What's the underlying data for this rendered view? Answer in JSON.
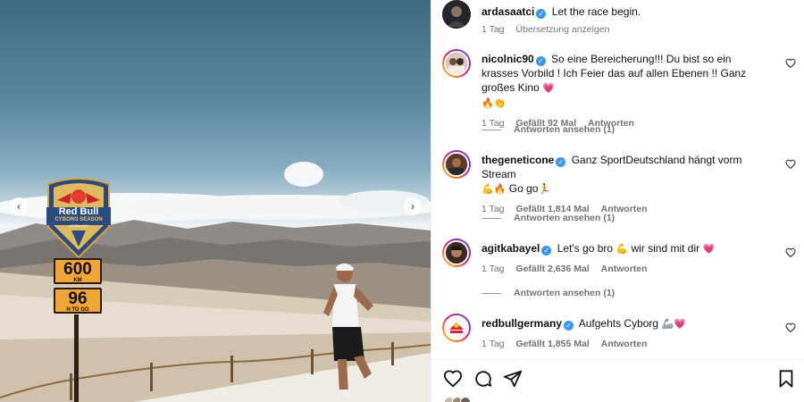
{
  "photo": {
    "sign": {
      "brand": "Red Bull",
      "event": "CYBORG SEASON",
      "sub": "ULTRA 600",
      "distance_value": "600",
      "distance_unit": "KM",
      "hours_value": "96",
      "hours_unit": "H TO GO"
    },
    "prev_icon": "chevron-left-icon",
    "next_icon": "chevron-right-icon"
  },
  "caption": {
    "username": "ardasaatci",
    "text": "Let the race begin.",
    "age": "1 Tag",
    "translate_label": "Übersetzung anzeigen"
  },
  "comments": [
    {
      "username": "nicolnic90",
      "text": "So eine Bereicherung!!! Du bist so ein krasses Vorbild ! Ich Feier das auf allen Ebenen !! Ganz großes Kino",
      "emoji_inline": "💗",
      "emoji_line2": "🔥👏",
      "age": "1 Tag",
      "likes": "Gefällt 92 Mal",
      "reply_label": "Antworten",
      "view_replies": "Antworten ansehen (1)"
    },
    {
      "username": "thegeneticone",
      "text": "Ganz SportDeutschland hängt vorm Stream",
      "emoji_line2": "💪🔥",
      "text2": "Go go",
      "emoji_end": "🏃",
      "age": "1 Tag",
      "likes": "Gefällt 1,814 Mal",
      "reply_label": "Antworten",
      "view_replies": "Antworten ansehen (1)"
    },
    {
      "username": "agitkabayel",
      "text": "Let's go bro",
      "emoji_mid": "💪",
      "text2": "wir sind mit dir",
      "emoji_end": "💗",
      "age": "1 Tag",
      "likes": "Gefällt 2,636 Mal",
      "reply_label": "Antworten",
      "view_replies": "Antworten ansehen (1)"
    },
    {
      "username": "redbullgermany",
      "text": "Aufgehts Cyborg",
      "emoji_end": "🦾💗",
      "age": "1 Tag",
      "likes": "Gefällt 1,855 Mal",
      "reply_label": "Antworten"
    }
  ],
  "actions": {
    "like_icon": "heart-icon",
    "comment_icon": "comment-icon",
    "share_icon": "share-icon",
    "save_icon": "bookmark-icon"
  },
  "colors": {
    "verified": "#3897f0",
    "muted": "#737373",
    "heart": "#ed4956"
  }
}
